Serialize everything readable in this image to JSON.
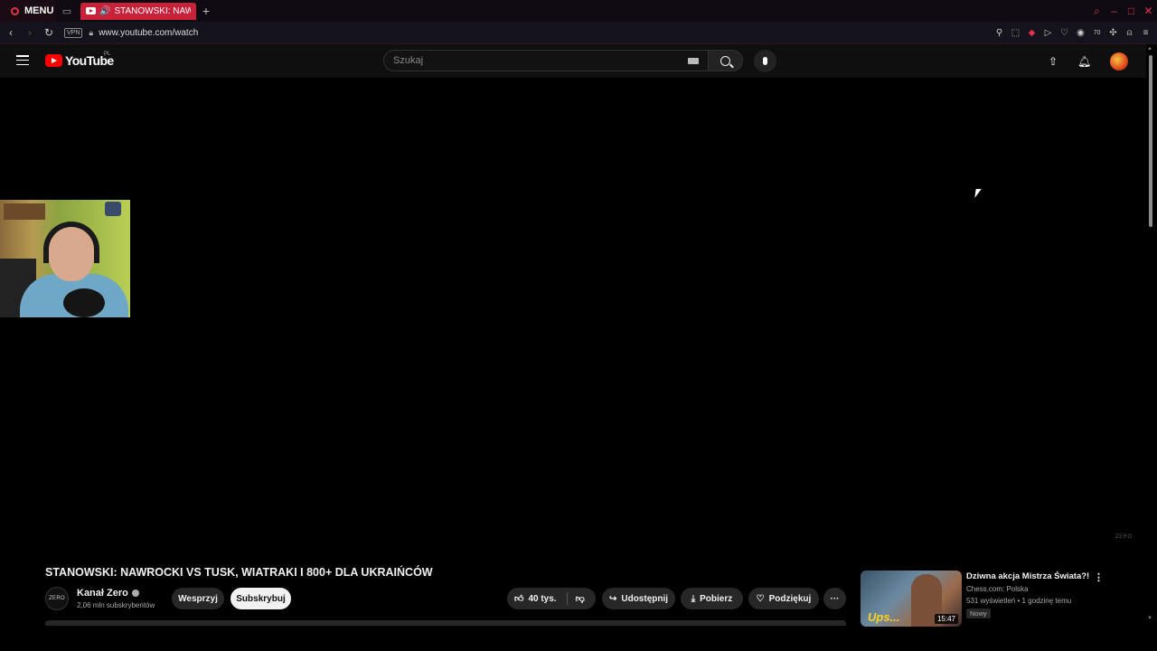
{
  "browser": {
    "menu_label": "MENU",
    "tab_title": "STANOWSKI: NAWROCKI VS TUSK",
    "url": "www.youtube.com/watch",
    "vpn_label": "VPN",
    "accent_color": "#e0314b",
    "extension_icons": [
      "pin-icon",
      "snapshot-icon",
      "pocket-icon",
      "play-icon",
      "heart-icon",
      "account-icon",
      "extension-badge-icon",
      "puzzle-icon",
      "profile-icon",
      "menu-icon"
    ],
    "extension_badge": "70"
  },
  "youtube": {
    "logo_text": "YouTube",
    "region": "PL",
    "search_placeholder": "Szukaj",
    "brand_color": "#ff0000"
  },
  "player": {
    "watermark": "ZERO"
  },
  "video": {
    "title": "STANOWSKI: NAWROCKI VS TUSK, WIATRAKI I 800+ DLA UKRAIŃCÓW",
    "channel_name": "Kanał Zero",
    "channel_avatar_text": "ZERO",
    "subscribers": "2,06 mln subskrybentów",
    "support_label": "Wesprzyj",
    "subscribe_label": "Subskrybuj",
    "likes": "40 tys.",
    "share_label": "Udostępnij",
    "download_label": "Pobierz",
    "thanks_label": "Podziękuj"
  },
  "recommended": {
    "title": "Dziwna akcja Mistrza Świata?!",
    "channel": "Chess.com: Polska",
    "meta": "531 wyświetleń • 1 godzinę temu",
    "badge": "Nowy",
    "duration": "15:47",
    "thumb_text": "Ups..."
  }
}
